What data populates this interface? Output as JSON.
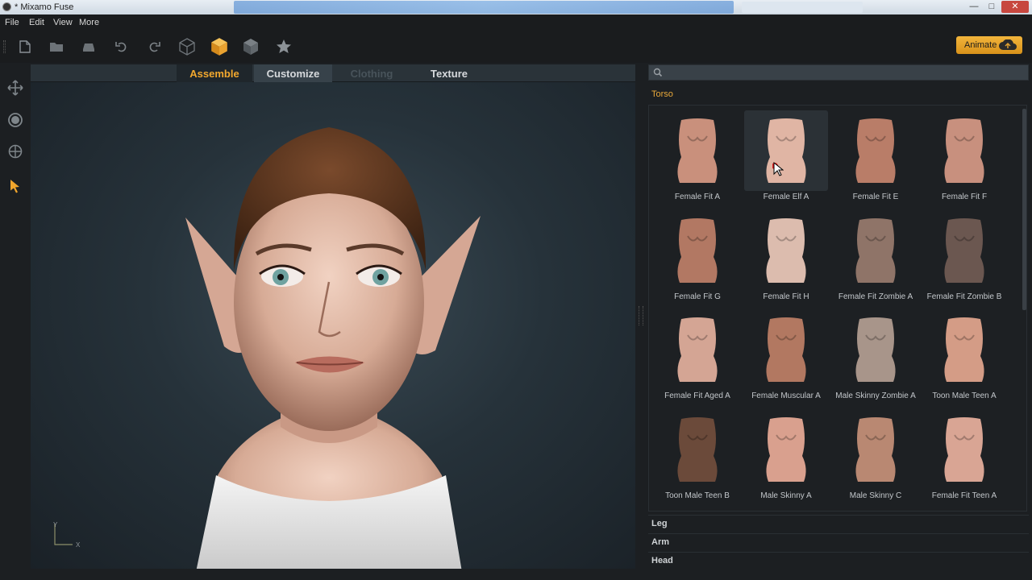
{
  "window": {
    "title": "* Mixamo Fuse"
  },
  "menu": [
    "File",
    "Edit",
    "View",
    "More"
  ],
  "toolbar": {
    "animate_label": "Animate",
    "icons": [
      "new-file-icon",
      "open-folder-icon",
      "save-icon",
      "undo-icon",
      "redo-icon",
      "wireframe-cube-icon",
      "solid-cube-icon",
      "shaded-cube-icon",
      "star-icon"
    ]
  },
  "left_tools": [
    "move-tool-icon",
    "rotate-tool-icon",
    "target-tool-icon",
    "select-pointer-icon"
  ],
  "tabs": [
    {
      "label": "Assemble",
      "state": "active"
    },
    {
      "label": "Customize",
      "state": "normal"
    },
    {
      "label": "Clothing",
      "state": "disabled"
    },
    {
      "label": "Texture",
      "state": "normal"
    }
  ],
  "axis": {
    "y": "Y",
    "x": "X"
  },
  "search": {
    "placeholder": "",
    "value": ""
  },
  "category": "Torso",
  "items": [
    {
      "label": "Female Fit A",
      "tone": "#c9907c"
    },
    {
      "label": "Female Elf A",
      "tone": "#e0b5a4",
      "selected": true
    },
    {
      "label": "Female Fit E",
      "tone": "#b97d68"
    },
    {
      "label": "Female Fit F",
      "tone": "#c8907e"
    },
    {
      "label": "Female Fit G",
      "tone": "#b27863"
    },
    {
      "label": "Female Fit H",
      "tone": "#dcbcae"
    },
    {
      "label": "Female Fit Zombie A",
      "tone": "#8f7468"
    },
    {
      "label": "Female Fit Zombie B",
      "tone": "#6b5750"
    },
    {
      "label": "Female Fit Aged A",
      "tone": "#d4a594"
    },
    {
      "label": "Female Muscular A",
      "tone": "#b27861"
    },
    {
      "label": "Male Skinny Zombie A",
      "tone": "#a8958a"
    },
    {
      "label": "Toon Male Teen A",
      "tone": "#d49c86"
    },
    {
      "label": "Toon Male Teen B",
      "tone": "#6b4a3a"
    },
    {
      "label": "Male Skinny A",
      "tone": "#d9a08e"
    },
    {
      "label": "Male Skinny C",
      "tone": "#b98872"
    },
    {
      "label": "Female Fit Teen A",
      "tone": "#d9a594"
    }
  ],
  "sections": [
    "Leg",
    "Arm",
    "Head"
  ]
}
